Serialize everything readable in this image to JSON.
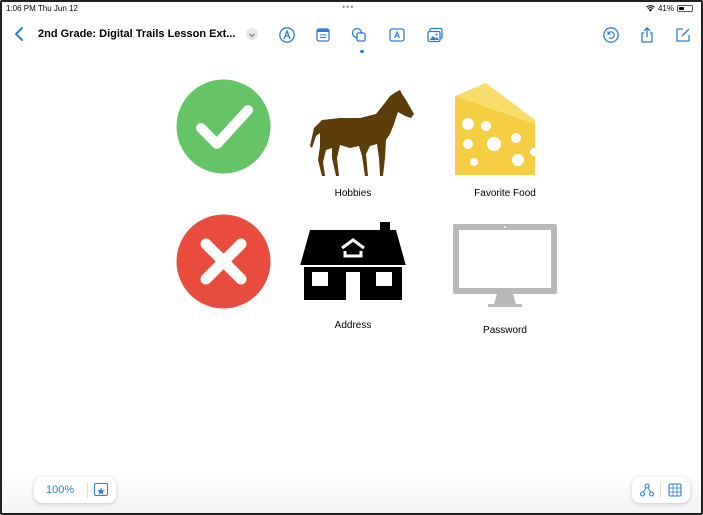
{
  "status": {
    "time": "1:06 PM  Thu Jun 12",
    "dots": "•••",
    "battery": "41%",
    "battery_level": 0.41
  },
  "toolbar": {
    "title": "2nd Grade: Digital Trails Lesson Ext...",
    "tools": [
      "pen-tip-icon",
      "sticky-note-icon",
      "shapes-icon",
      "text-box-icon",
      "media-icon"
    ],
    "actions": [
      "undo-icon",
      "share-icon",
      "compose-icon"
    ],
    "accent": "#2b7cd8"
  },
  "board": {
    "items": [
      {
        "name": "check-mark-icon",
        "caption": ""
      },
      {
        "name": "horse-icon",
        "caption": "Hobbies"
      },
      {
        "name": "cheese-icon",
        "caption": "Favorite Food"
      },
      {
        "name": "x-mark-icon",
        "caption": ""
      },
      {
        "name": "house-icon",
        "caption": "Address"
      },
      {
        "name": "monitor-icon",
        "caption": "Password"
      }
    ],
    "colors": {
      "green": "#65c466",
      "red": "#e94b3c",
      "horse": "#5c3d0a",
      "cheese": "#f5cd42",
      "monitor": "#b8b8b8"
    }
  },
  "bottom": {
    "zoom": "100%"
  }
}
